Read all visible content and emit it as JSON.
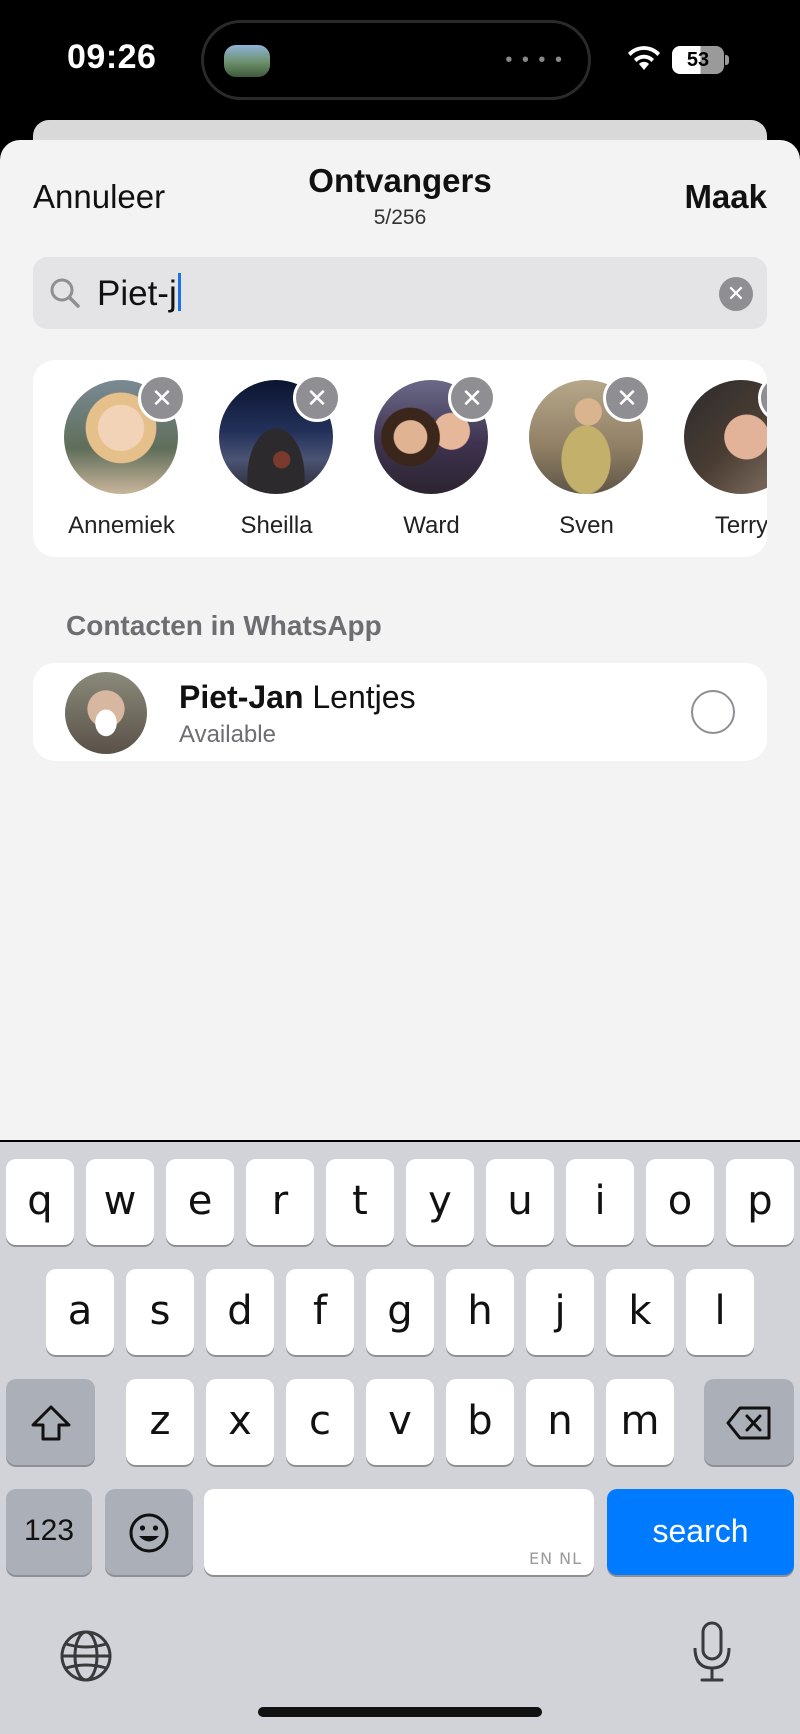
{
  "status_bar": {
    "time": "09:26",
    "battery": "53"
  },
  "nav": {
    "cancel_label": "Annuleer",
    "title": "Ontvangers",
    "subtitle": "5/256",
    "create_label": "Maak"
  },
  "search": {
    "value": "Piet-j"
  },
  "selected": [
    {
      "name": "Annemiek"
    },
    {
      "name": "Sheilla"
    },
    {
      "name": "Ward"
    },
    {
      "name": "Sven"
    },
    {
      "name": "Terry"
    }
  ],
  "section": {
    "header": "Contacten in WhatsApp"
  },
  "contact": {
    "name_bold": "Piet-Jan",
    "name_rest": " Lentjes",
    "status": "Available"
  },
  "keyboard": {
    "row1": [
      "q",
      "w",
      "e",
      "r",
      "t",
      "y",
      "u",
      "i",
      "o",
      "p"
    ],
    "row2": [
      "a",
      "s",
      "d",
      "f",
      "g",
      "h",
      "j",
      "k",
      "l"
    ],
    "row3": [
      "z",
      "x",
      "c",
      "v",
      "b",
      "n",
      "m"
    ],
    "numbers_label": "123",
    "space_hint": "EN NL",
    "search_label": "search"
  },
  "colors": {
    "accent": "#007aff",
    "sheet": "#f3f3f3",
    "keyboard": "#d1d3d9"
  }
}
